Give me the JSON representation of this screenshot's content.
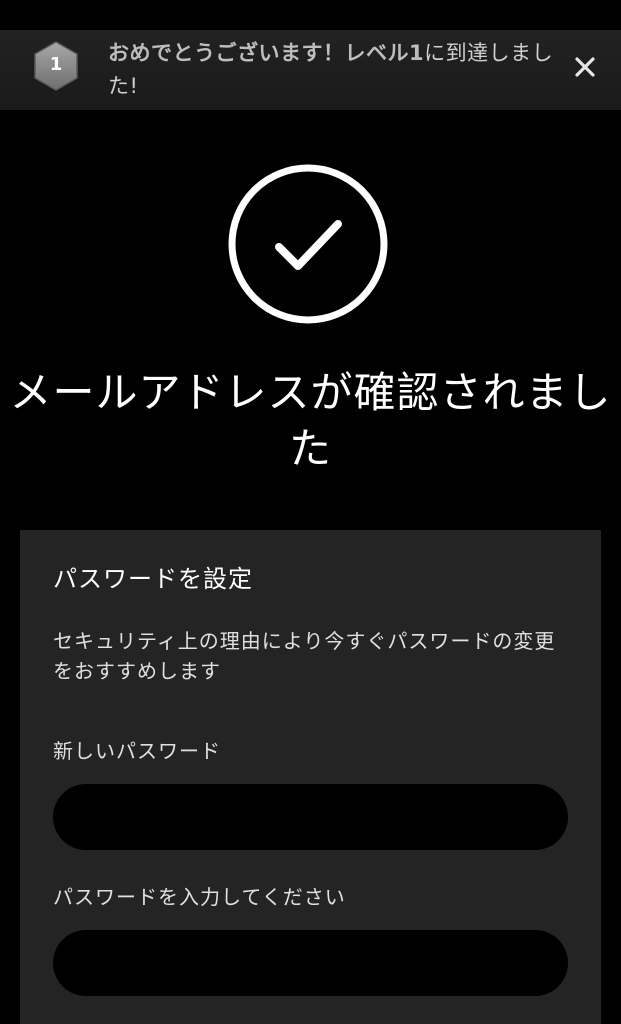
{
  "toast": {
    "level_number": "1",
    "message_strong": "おめでとうございます！レベル1",
    "message_rest": "に到達しました!",
    "icons": {
      "badge": "hexagon-badge-icon",
      "close": "close-icon"
    }
  },
  "status": {
    "icon": "check-circle-icon",
    "title": "メールアドレスが確認されました"
  },
  "card": {
    "title": "パスワードを設定",
    "description": "セキュリティ上の理由により今すぐパスワードの変更をおすすめします",
    "new_password": {
      "label": "新しいパスワード",
      "value": "",
      "placeholder": ""
    },
    "confirm_password": {
      "label": "パスワードを入力してください",
      "value": "",
      "placeholder": ""
    }
  },
  "colors": {
    "background": "#000000",
    "card": "#242424",
    "toast": "#1f1f1f",
    "badge": "#8a8a8a",
    "text": "#ffffff"
  }
}
